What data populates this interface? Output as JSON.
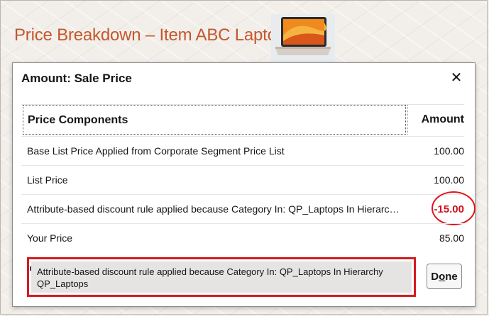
{
  "page": {
    "title": "Price Breakdown – Item ABC Laptop"
  },
  "dialog": {
    "title": "Amount: Sale Price",
    "close_icon": "close-icon",
    "columns": {
      "components": "Price Components",
      "amount": "Amount"
    },
    "rows": [
      {
        "description": "Base List Price Applied from Corporate Segment Price List",
        "amount": "100.00"
      },
      {
        "description": "List Price",
        "amount": "100.00"
      },
      {
        "description": "Attribute-based discount rule applied because Category In: QP_Laptops In Hierarchy QP_Laptops",
        "amount": "-15.00"
      },
      {
        "description": "Your Price",
        "amount": "85.00"
      }
    ],
    "tooltip": "Attribute-based discount rule applied because Category In: QP_Laptops In Hierarchy QP_Laptops",
    "done_label_pre": "D",
    "done_label_mnemonic": "o",
    "done_label_post": "ne"
  },
  "colors": {
    "title": "#c4582d",
    "negative": "#d1111c",
    "highlight": "#d51a21"
  }
}
